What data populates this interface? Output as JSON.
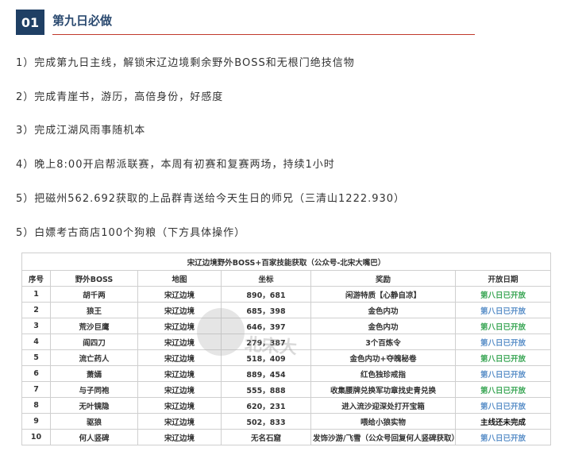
{
  "header": {
    "number": "01",
    "title": "第九日必做"
  },
  "items": [
    "1）完成第九日主线，解锁宋辽边境剩余野外BOSS和无根门绝技信物",
    "2）完成青崖书，游历，高倍身份，好感度",
    "3）完成江湖风雨事随机本",
    "4）晚上8:00开启帮派联赛，本周有初赛和复赛两场，持续1小时",
    "5）把磁州562.692获取的上品群青送给今天生日的师兄（三清山1222.930）",
    "5）白嫖考古商店100个狗粮（下方具体操作）"
  ],
  "table": {
    "caption": "宋辽边境野外BOSS+百家技能获取（公众号-北宋大嘴巴）",
    "headers": [
      "序号",
      "野外BOSS",
      "地图",
      "坐标",
      "奖励",
      "开放日期"
    ],
    "rows": [
      [
        "1",
        "胡千两",
        "宋辽边境",
        "890，681",
        "闲游特质【心静自凉】",
        "第八日已开放"
      ],
      [
        "2",
        "狼王",
        "宋辽边境",
        "685，398",
        "金色内功",
        "第八日已开放"
      ],
      [
        "3",
        "荒沙巨鹰",
        "宋辽边境",
        "646，397",
        "金色内功",
        "第八日已开放"
      ],
      [
        "4",
        "阎四刀",
        "宋辽边境",
        "279，387",
        "3个百炼令",
        "第八日已开放"
      ],
      [
        "5",
        "流亡药人",
        "宋辽边境",
        "518，409",
        "金色内功+夺魄秘卷",
        "第八日已开放"
      ],
      [
        "6",
        "萧嫣",
        "宋辽边境",
        "889，454",
        "红色独珍戒指",
        "第八日已开放"
      ],
      [
        "7",
        "与子同袍",
        "宋辽边境",
        "555，888",
        "收集腰牌兑换军功章找史青兑换",
        "第八日已开放"
      ],
      [
        "8",
        "无叶镜隐",
        "宋辽边境",
        "620，231",
        "进入流沙迎深处打开宝箱",
        "第八日已开放"
      ],
      [
        "9",
        "驱狼",
        "宋辽边境",
        "502，833",
        "喂给小狼实物",
        "主线还未完成"
      ],
      [
        "10",
        "何人竖碑",
        "宋辽边境",
        "无名石窟",
        "发饰沙游/飞雪（公众号回复何人竖碑获取）",
        "第八日已开放"
      ]
    ],
    "date_colors": [
      "green",
      "blue",
      "green",
      "blue",
      "green",
      "blue",
      "green",
      "blue",
      "black",
      "blue"
    ]
  },
  "watermark": "北宋大"
}
